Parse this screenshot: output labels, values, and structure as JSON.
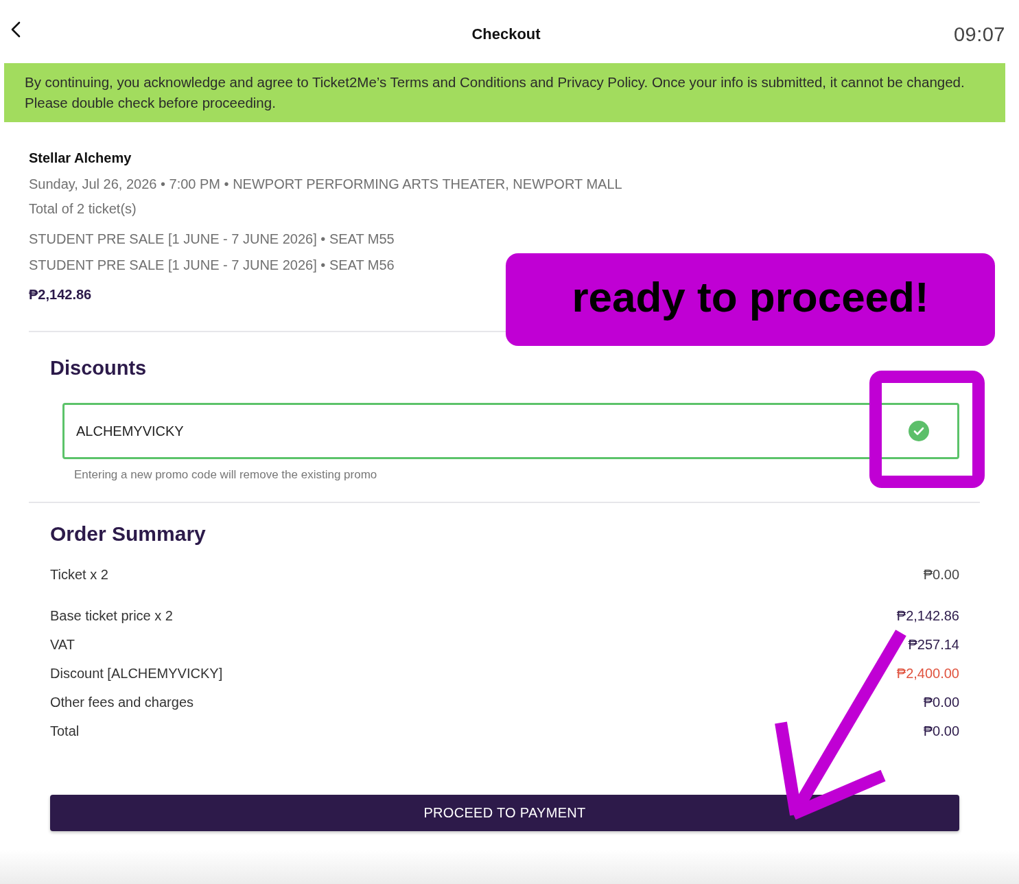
{
  "header": {
    "title": "Checkout",
    "time": "09:07"
  },
  "notice": "By continuing, you acknowledge and agree to Ticket2Me’s Terms and Conditions and Privacy Policy. Once your info is submitted, it cannot be changed. Please double check before proceeding.",
  "event": {
    "name": "Stellar Alchemy",
    "details": "Sunday, Jul 26, 2026 • 7:00 PM • NEWPORT PERFORMING ARTS THEATER, NEWPORT MALL",
    "ticket_count": "Total of 2 ticket(s)",
    "tickets": [
      "STUDENT PRE SALE [1 JUNE - 7 JUNE 2026] • SEAT M55",
      "STUDENT PRE SALE [1 JUNE - 7 JUNE 2026] • SEAT M56"
    ],
    "price": "₱2,142.86"
  },
  "discounts": {
    "heading": "Discounts",
    "promo": {
      "value": "ALCHEMYVICKY",
      "valid": true,
      "hint": "Entering a new promo code will remove the existing promo"
    }
  },
  "order_summary": {
    "heading": "Order Summary",
    "ticket_line": {
      "label": "Ticket x 2",
      "value": "₱0.00"
    },
    "rows": [
      {
        "label": "Base ticket price x 2",
        "value": "₱2,142.86",
        "kind": "amount"
      },
      {
        "label": "VAT",
        "value": "₱257.14",
        "kind": "amount"
      },
      {
        "label": "Discount [ALCHEMYVICKY]",
        "value": "₱2,400.00",
        "kind": "discount"
      },
      {
        "label": "Other fees and charges",
        "value": "₱0.00",
        "kind": "amount"
      },
      {
        "label": "Total",
        "value": "₱0.00",
        "kind": "amount"
      }
    ]
  },
  "proceed_button": "PROCEED TO PAYMENT",
  "annotations": [
    {
      "kind": "callout",
      "text": "ready to proceed!"
    },
    {
      "kind": "highlight"
    },
    {
      "kind": "arrow"
    }
  ]
}
